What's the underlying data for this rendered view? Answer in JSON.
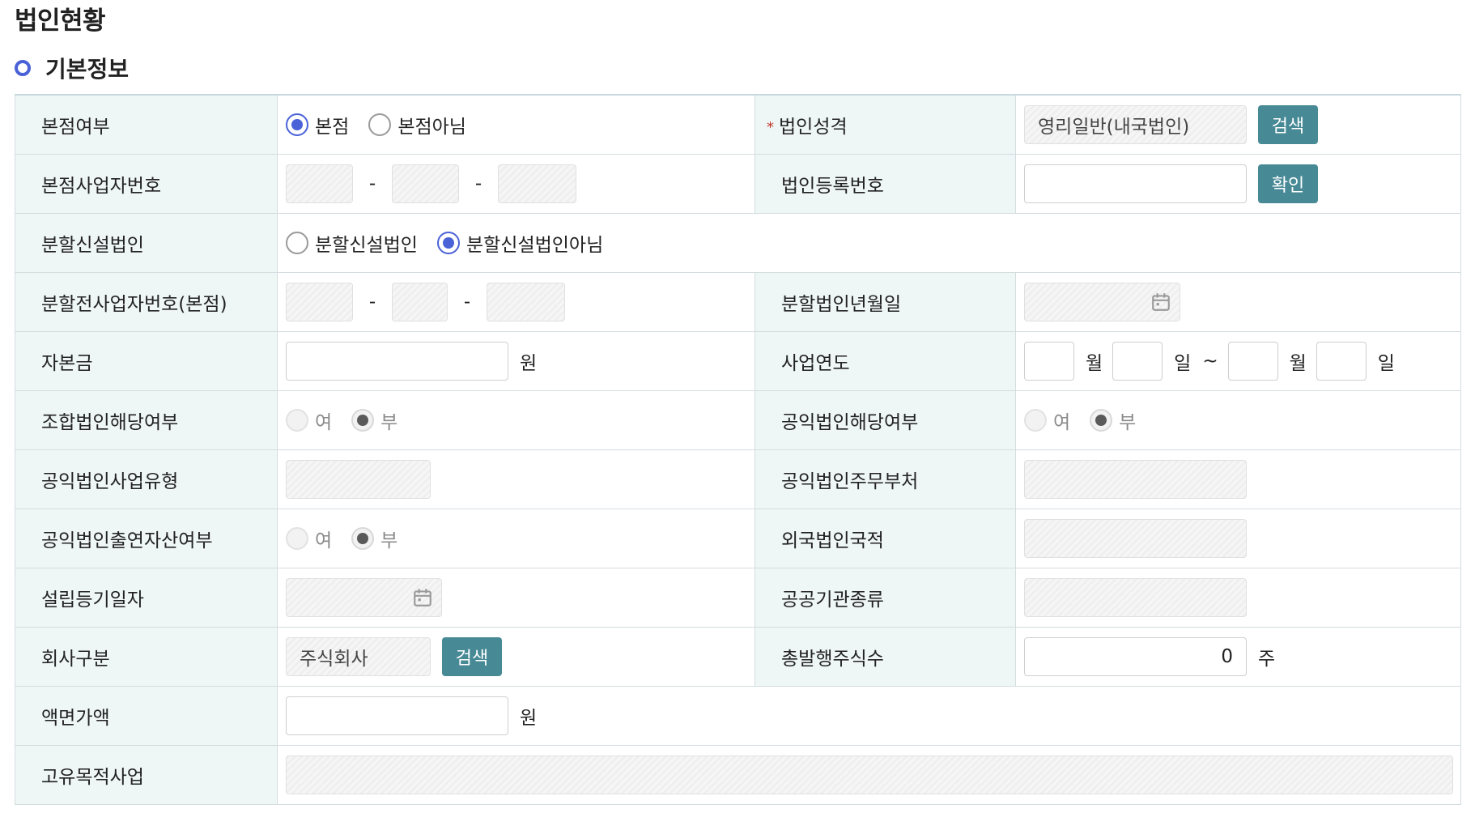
{
  "page_title": "법인현황",
  "section_title": "기본정보",
  "labels": {
    "head_office": "본점여부",
    "corp_type": "법인성격",
    "head_biz_no": "본점사업자번호",
    "corp_reg_no": "법인등록번호",
    "split_corp": "분할신설법인",
    "pre_split_biz_no": "분할전사업자번호(본점)",
    "split_date": "분할법인년월일",
    "capital": "자본금",
    "fiscal_year": "사업연도",
    "coop_corp": "조합법인해당여부",
    "public_corp": "공익법인해당여부",
    "public_biz_type": "공익법인사업유형",
    "public_ministry": "공익법인주무부처",
    "public_asset": "공익법인출연자산여부",
    "foreign_nat": "외국법인국적",
    "est_date": "설립등기일자",
    "public_inst": "공공기관종류",
    "company_type": "회사구분",
    "total_shares": "총발행주식수",
    "par_value": "액면가액",
    "unique_biz": "고유목적사업"
  },
  "required_mark": "*",
  "options": {
    "head_office_yes": "본점",
    "head_office_no": "본점아님",
    "split_yes": "분할신설법인",
    "split_no": "분할신설법인아님",
    "yes": "여",
    "no": "부"
  },
  "values": {
    "corp_type": "영리일반(내국법인)",
    "company_type": "주식회사",
    "total_shares": "0",
    "corp_reg_no": "",
    "capital": "",
    "par_value": ""
  },
  "buttons": {
    "search": "검색",
    "confirm": "확인"
  },
  "units": {
    "won": "원",
    "month": "월",
    "day": "일",
    "tilde": "~",
    "shares": "주",
    "dash": "-"
  },
  "selected": {
    "head_office": "본점",
    "split": "분할신설법인아님",
    "coop_corp": "부",
    "public_corp": "부",
    "public_asset": "부"
  },
  "colors": {
    "accent": "#4a62d8",
    "button": "#478a96",
    "label_bg": "#eff6f6",
    "required": "#c0392b"
  }
}
